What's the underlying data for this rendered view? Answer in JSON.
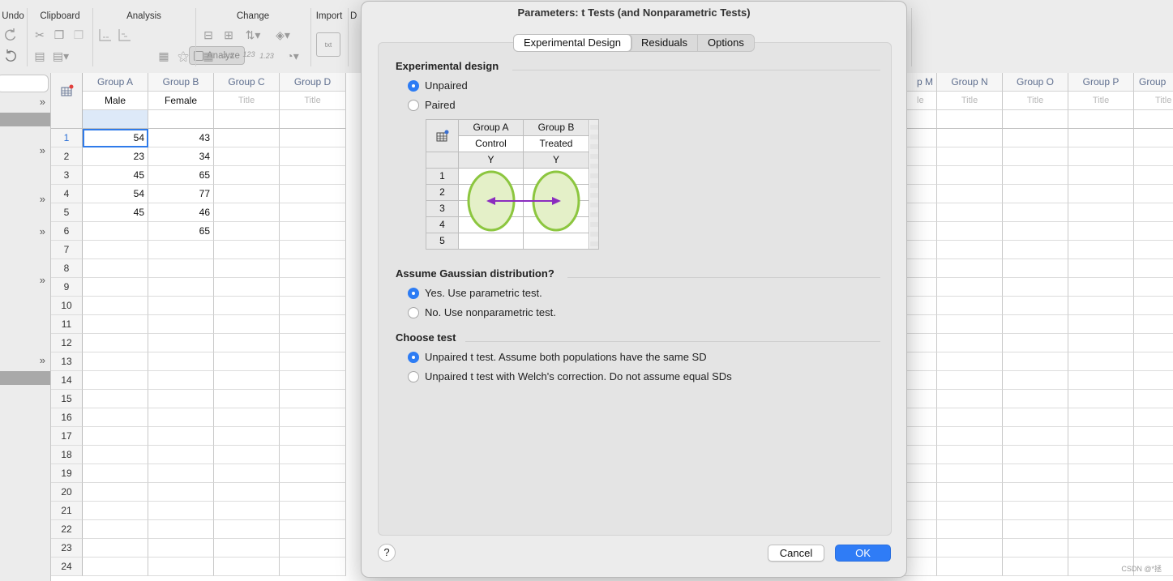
{
  "ribbon": {
    "groups": [
      "Undo",
      "Clipboard",
      "Analysis",
      "Change",
      "Import",
      "D"
    ],
    "analyze_label": "Analyze"
  },
  "sheet": {
    "columns": [
      {
        "header": "Group A",
        "title": "Male"
      },
      {
        "header": "Group B",
        "title": "Female"
      },
      {
        "header": "Group C",
        "title": "Title"
      },
      {
        "header": "Group D",
        "title": "Title"
      }
    ],
    "right_columns": [
      {
        "header": "p M",
        "title": "le"
      },
      {
        "header": "Group N",
        "title": "Title"
      },
      {
        "header": "Group O",
        "title": "Title"
      },
      {
        "header": "Group P",
        "title": "Title"
      },
      {
        "header": "Group",
        "title": "Title"
      }
    ],
    "rows": [
      "1",
      "2",
      "3",
      "4",
      "5",
      "6",
      "7",
      "8",
      "9",
      "10",
      "11",
      "12",
      "13",
      "14",
      "15",
      "16",
      "17",
      "18",
      "19",
      "20",
      "21",
      "22",
      "23",
      "24"
    ],
    "group_a": [
      "54",
      "23",
      "45",
      "54",
      "45",
      "",
      "",
      "",
      "",
      "",
      "",
      "",
      "",
      "",
      "",
      "",
      "",
      "",
      "",
      "",
      "",
      "",
      "",
      ""
    ],
    "group_b": [
      "43",
      "34",
      "65",
      "77",
      "46",
      "65",
      "",
      "",
      "",
      "",
      "",
      "",
      "",
      "",
      "",
      "",
      "",
      "",
      "",
      "",
      "",
      "",
      "",
      ""
    ]
  },
  "dialog": {
    "title": "Parameters: t Tests (and Nonparametric Tests)",
    "tabs": [
      "Experimental Design",
      "Residuals",
      "Options"
    ],
    "sections": {
      "design": {
        "heading": "Experimental design",
        "options": [
          "Unpaired",
          "Paired"
        ]
      },
      "gaussian": {
        "heading": "Assume Gaussian distribution?",
        "options": [
          "Yes. Use parametric test.",
          "No. Use nonparametric test."
        ]
      },
      "test": {
        "heading": "Choose test",
        "options": [
          "Unpaired t test. Assume both populations have the same SD",
          "Unpaired t test with Welch's correction. Do not assume equal SDs"
        ]
      }
    },
    "mini_table": {
      "headers": [
        "Group A",
        "Group B"
      ],
      "titles": [
        "Control",
        "Treated"
      ],
      "sub": [
        "Y",
        "Y"
      ],
      "rows": [
        "1",
        "2",
        "3",
        "4",
        "5"
      ]
    },
    "buttons": {
      "help": "?",
      "cancel": "Cancel",
      "ok": "OK"
    }
  },
  "watermark": "CSDN @*拯"
}
